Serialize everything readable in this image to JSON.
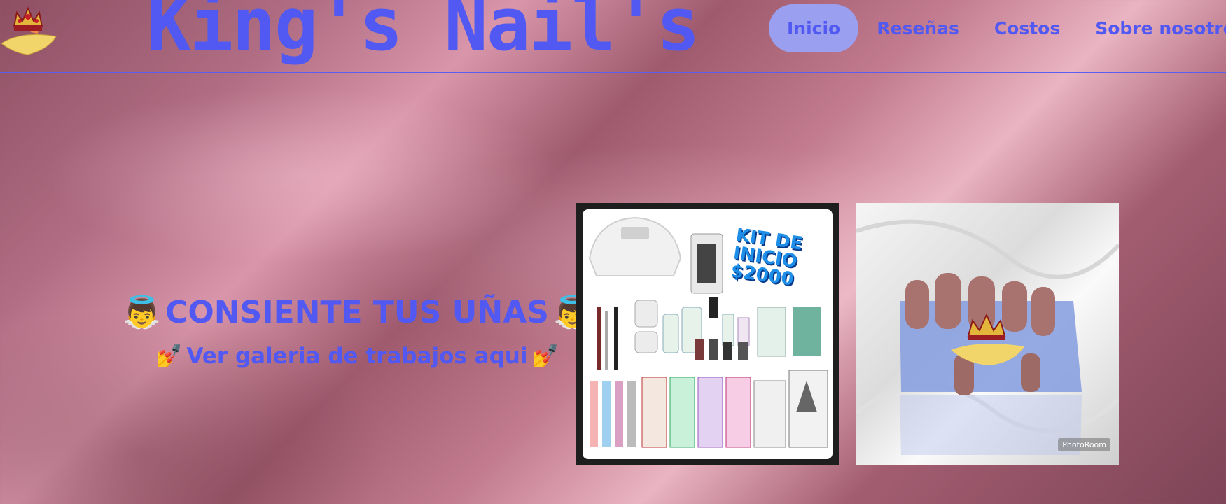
{
  "header": {
    "brand": "King's Nail's",
    "logo_icon": "crown-logo-icon"
  },
  "nav": {
    "items": [
      {
        "label": "Inicio",
        "active": true
      },
      {
        "label": "Reseñas",
        "active": false
      },
      {
        "label": "Costos",
        "active": false
      },
      {
        "label": "Sobre nosotros",
        "active": false
      }
    ]
  },
  "hero": {
    "title": "CONSIENTE TUS UÑAS",
    "title_emoji": "👼",
    "gallery_link": "Ver galeria de trabajos aqui",
    "gallery_emoji": "💅"
  },
  "gallery": {
    "kit_label": "KIT DE INICIO $2000",
    "kit_line1": "KIT DE",
    "kit_line2": "INICIO",
    "kit_line3": "$2000",
    "watermark": "PhotoRoom"
  },
  "colors": {
    "accent": "#5159f2",
    "nav_active_bg": "#9aa0ef"
  }
}
